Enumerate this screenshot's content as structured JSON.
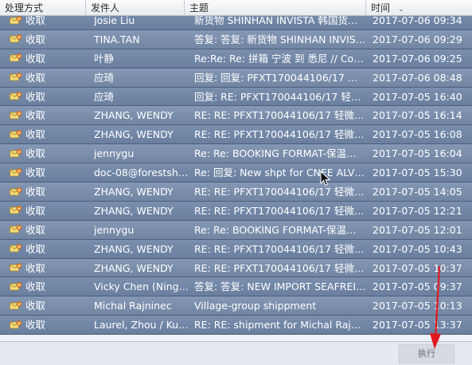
{
  "columns": {
    "action": "处理方式",
    "sender": "发件人",
    "subject": "主题",
    "time": "时间"
  },
  "rows": [
    {
      "action": "收取",
      "sender": "Josie Liu",
      "subject": "新货物  SHINHAN INVISTA  韩国货物 ...",
      "time": "2017-07-06 09:34"
    },
    {
      "action": "收取",
      "sender": "TINA.TAN",
      "subject": "答复: 答复: 新货物   SHINHAN INVIST...",
      "time": "2017-07-06 09:29"
    },
    {
      "action": "收取",
      "sender": "叶静",
      "subject": "Re:Re: Re: 拼箱  宁波 到 悉尼  // Cons...",
      "time": "2017-07-06 09:25"
    },
    {
      "action": "收取",
      "sender": "应琦",
      "subject": "回复: 回复: PFXT170044106/17 轻微变...",
      "time": "2017-07-06 08:48"
    },
    {
      "action": "收取",
      "sender": "应琦",
      "subject": "回复: RE: PFXT170044106/17 轻微变形...",
      "time": "2017-07-05 16:40"
    },
    {
      "action": "收取",
      "sender": "ZHANG, WENDY",
      "subject": "RE: RE: PFXT170044106/17 轻微变形 ...",
      "time": "2017-07-05 16:14"
    },
    {
      "action": "收取",
      "sender": "ZHANG, WENDY",
      "subject": "RE: RE: PFXT170044106/17 轻微变形 ...",
      "time": "2017-07-05 16:08"
    },
    {
      "action": "收取",
      "sender": "jennygu",
      "subject": "Re: Re: BOOKING FORMAT-保温杯93...",
      "time": "2017-07-05 16:04"
    },
    {
      "action": "收取",
      "sender": "doc-08@forestship...",
      "subject": "Re: 回复: New shpt for CNEE ALVIN ...",
      "time": "2017-07-05 15:30"
    },
    {
      "action": "收取",
      "sender": "ZHANG, WENDY",
      "subject": "RE: RE: PFXT170044106/17 轻微变形 ...",
      "time": "2017-07-05 14:05"
    },
    {
      "action": "收取",
      "sender": "ZHANG, WENDY",
      "subject": "RE: RE: PFXT170044106/17 轻微变形 ...",
      "time": "2017-07-05 12:21"
    },
    {
      "action": "收取",
      "sender": "jennygu",
      "subject": "Re: Re: BOOKING FORMAT-保温杯93...",
      "time": "2017-07-05 12:01"
    },
    {
      "action": "收取",
      "sender": "ZHANG, WENDY",
      "subject": "RE: RE: PFXT170044106/17 轻微变形 ...",
      "time": "2017-07-05 10:43"
    },
    {
      "action": "收取",
      "sender": "ZHANG, WENDY",
      "subject": "RE: RE: PFXT170044106/17 轻微变形 ...",
      "time": "2017-07-05 10:37"
    },
    {
      "action": "收取",
      "sender": "Vicky Chen (Ningbo)",
      "subject": "答复: 答复: NEW IMPORT SEAFREIGH...",
      "time": "2017-07-05 09:37"
    },
    {
      "action": "收取",
      "sender": "Michal Rajninec",
      "subject": "Village-group shippment",
      "time": "2017-07-05 10:13"
    },
    {
      "action": "收取",
      "sender": "Laurel, Zhou / Kue...",
      "subject": "RE: RE: shipment for Michal Rajninec...",
      "time": "2017-07-05 13:37"
    }
  ],
  "footer": {
    "button_label": "执行"
  },
  "colors": {
    "row_bg": "#7a8fae",
    "header_bg": "#f2f4f7",
    "arrow": "#e0191f"
  },
  "icons": {
    "row_icon": "mail-receive-icon",
    "sort_icon": "chevron-down-icon"
  }
}
